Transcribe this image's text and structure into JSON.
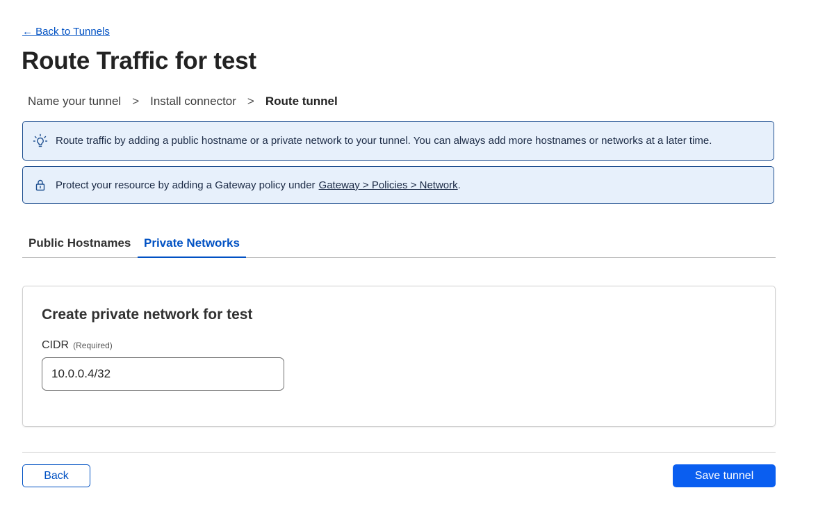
{
  "nav": {
    "back_link": "← Back to Tunnels"
  },
  "page": {
    "title": "Route Traffic for test"
  },
  "breadcrumb": {
    "steps": [
      "Name your tunnel",
      "Install connector",
      "Route tunnel"
    ],
    "separator": ">"
  },
  "banners": {
    "tip": {
      "icon": "lightbulb-icon",
      "text": "Route traffic by adding a public hostname or a private network to your tunnel. You can always add more hostnames or networks at a later time."
    },
    "lock": {
      "icon": "lock-icon",
      "text": "Protect your resource by adding a Gateway policy under",
      "link": "Gateway > Policies > Network",
      "suffix": "."
    }
  },
  "tabs": {
    "items": [
      "Public Hostnames",
      "Private Networks"
    ],
    "active": "Private Networks"
  },
  "form": {
    "title": "Create private network for test",
    "cidr_label": "CIDR",
    "cidr_required": "(Required)",
    "cidr_value": "10.0.0.4/32"
  },
  "actions": {
    "back_label": "Back",
    "save_label": "Save tunnel"
  },
  "colors": {
    "accent": "#0051c3",
    "primary_button": "#0a5ef0",
    "banner_bg": "#e7f0fb",
    "banner_border": "#1d4e8f"
  }
}
